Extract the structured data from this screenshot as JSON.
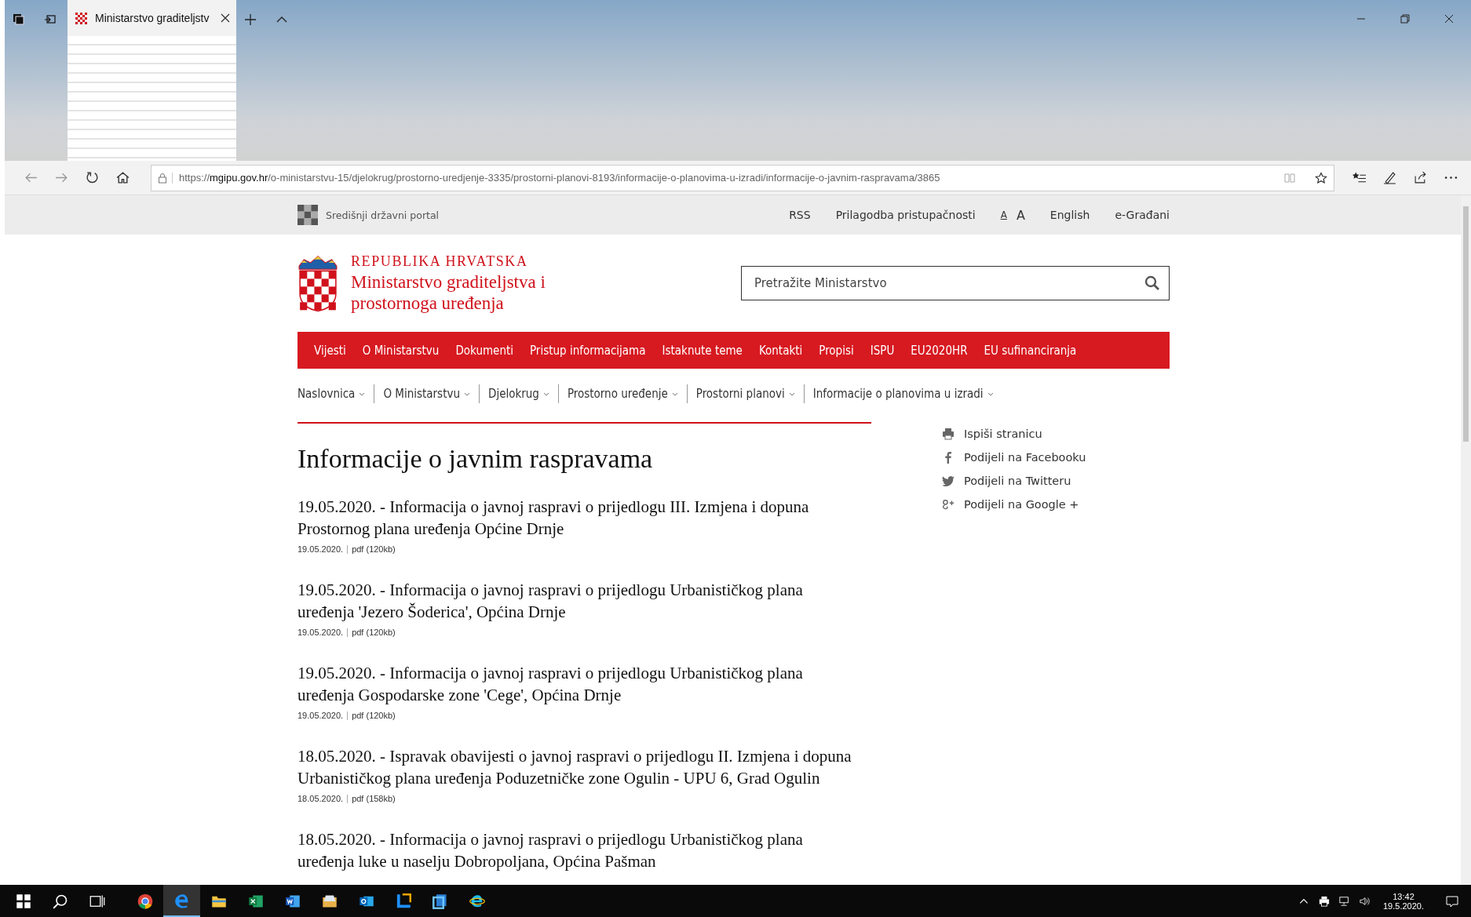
{
  "browser": {
    "tab": {
      "title": "Ministarstvo graditeljstv",
      "selected": true
    },
    "address": "https://**mgipu.gov.hr**/o-ministarstvu-15/djelokrug/prostorno-uredjenje-3335/prostorni-planovi-8193/informacije-o-planovima-u-izradi/informacije-o-javnim-raspravama/3865"
  },
  "utility_bar": {
    "portal": "Središnji državni portal",
    "links": [
      {
        "kind": "link",
        "label": "RSS"
      },
      {
        "kind": "link",
        "label": "Prilagodba pristupačnosti"
      },
      {
        "kind": "font-small",
        "label": "A"
      },
      {
        "kind": "font-large",
        "label": "A"
      },
      {
        "kind": "link",
        "label": "English"
      },
      {
        "kind": "link",
        "label": "e-Građani"
      }
    ]
  },
  "header": {
    "country": "REPUBLIKA HRVATSKA",
    "ministry": [
      "Ministarstvo graditeljstva i",
      "prostornoga uređenja"
    ],
    "search": {
      "placeholder": "Pretražite Ministarstvo"
    }
  },
  "main_nav": [
    "Vijesti",
    "O Ministarstvu",
    "Dokumenti",
    "Pristup informacijama",
    "Istaknute teme",
    "Kontakti",
    "Propisi",
    "ISPU",
    "EU2020HR",
    "EU sufinanciranja"
  ],
  "breadcrumb": [
    "Naslovnica",
    "O Ministarstvu",
    "Djelokrug",
    "Prostorno uređenje",
    "Prostorni planovi",
    "Informacije o planovima u izradi"
  ],
  "page_title": "Informacije o javnim raspravama",
  "documents": [
    {
      "title": "19.05.2020. - Informacija o javnoj raspravi o prijedlogu III. Izmjena i dopuna Prostornog plana uređenja Općine Drnje",
      "date": "19.05.2020.",
      "file": "pdf (120kb)"
    },
    {
      "title": "19.05.2020. - Informacija o javnoj raspravi o prijedlogu Urbanističkog plana uređenja 'Jezero Šoderica', Općina Drnje",
      "date": "19.05.2020.",
      "file": "pdf (120kb)"
    },
    {
      "title": "19.05.2020. - Informacija o javnoj raspravi o prijedlogu Urbanističkog plana uređenja Gospodarske zone 'Cege', Općina Drnje",
      "date": "19.05.2020.",
      "file": "pdf (120kb)"
    },
    {
      "title": "18.05.2020. - Ispravak obavijesti o javnoj raspravi o prijedlogu II. Izmjena i dopuna Urbanističkog plana uređenja Poduzetničke zone Ogulin - UPU 6, Grad Ogulin",
      "date": "18.05.2020.",
      "file": "pdf (158kb)"
    },
    {
      "title": "18.05.2020. - Informacija o javnoj raspravi o prijedlogu Urbanističkog plana uređenja luke u naselju Dobropoljana, Općina Pašman"
    }
  ],
  "share_links": [
    {
      "kind": "print",
      "label": "Ispiši stranicu"
    },
    {
      "kind": "facebook",
      "label": "Podijeli na Facebooku"
    },
    {
      "kind": "twitter",
      "label": "Podijeli na Twitteru"
    },
    {
      "kind": "google",
      "label": "Podijeli na Google +"
    }
  ],
  "taskbar": {
    "time": "13:42",
    "date": "19.5.2020."
  }
}
